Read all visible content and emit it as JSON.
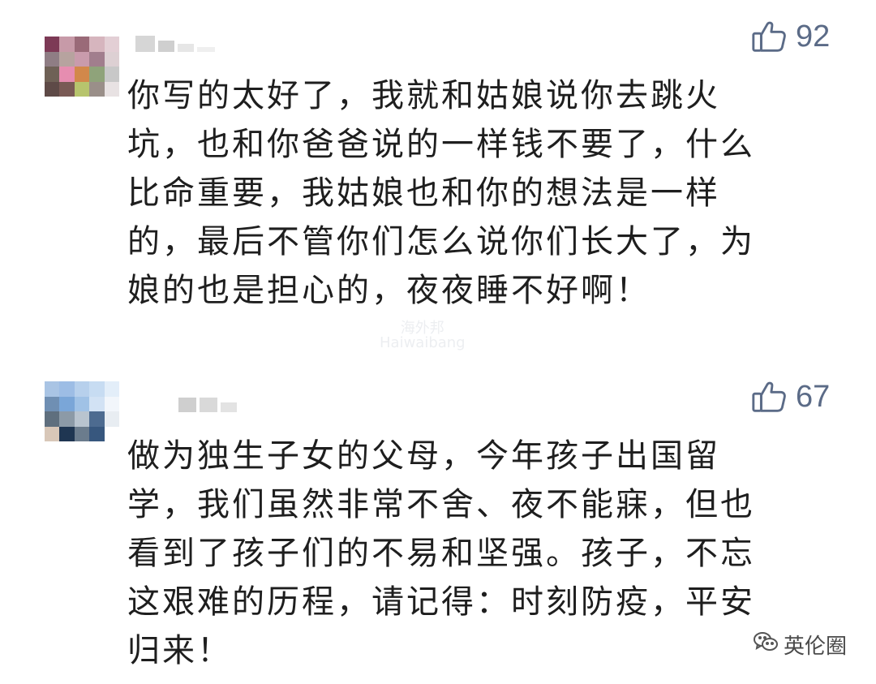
{
  "comments": [
    {
      "likes": "92",
      "text": "你写的太好了，我就和姑娘说你去跳火\n坑，也和你爸爸说的一样钱不要了，什么\n比命重要，我姑娘也和你的想法是一样\n的，最后不管你们怎么说你们长大了，为\n娘的也是担心的，夜夜睡不好啊！",
      "avatar_colors": [
        "#7d3a56",
        "#c79aa8",
        "#9a6a78",
        "#d6b5be",
        "#e3cfd5",
        "#8f7d84",
        "#b7a39f",
        "#c99bac",
        "#a17e8d",
        "#ddd0d3",
        "#6f6156",
        "#e68db0",
        "#d2884a",
        "#8fa37a",
        "#c8c8c8",
        "#5e4a47",
        "#7a5a55",
        "#b7c46d",
        "#9a8f89",
        "#e8e2e3"
      ]
    },
    {
      "likes": "67",
      "text": "做为独生子女的父母，今年孩子出国留\n学，我们虽然非常不舍、夜不能寐，但也\n看到了孩子们的不易和坚强。孩子，不忘\n这艰难的历程，请记得：时刻防疫，平安\n归来！",
      "avatar_colors": [
        "#a9c4e4",
        "#9dbde5",
        "#b7d0ec",
        "#c7dcf2",
        "#e3eef9",
        "#6f8fb3",
        "#7aa6d8",
        "#a0c2e6",
        "#d2e2f4",
        "#f2f6fb",
        "#5f6f7e",
        "#8c9aa7",
        "#b9c4cf",
        "#4d6b90",
        "#e8edf2",
        "#d8c7b8",
        "#1f3652",
        "#6b7c8d",
        "#37577e",
        "#ffffff"
      ]
    }
  ],
  "watermark": {
    "line1": "海外邦",
    "line2": "Haiwaibang"
  },
  "brand": {
    "name": "英伦圈"
  },
  "icons": {
    "like": "thumbs-up-icon",
    "brand": "wechat-icon"
  },
  "colors": {
    "like": "#5b6b87",
    "text": "#1e1e1e"
  }
}
